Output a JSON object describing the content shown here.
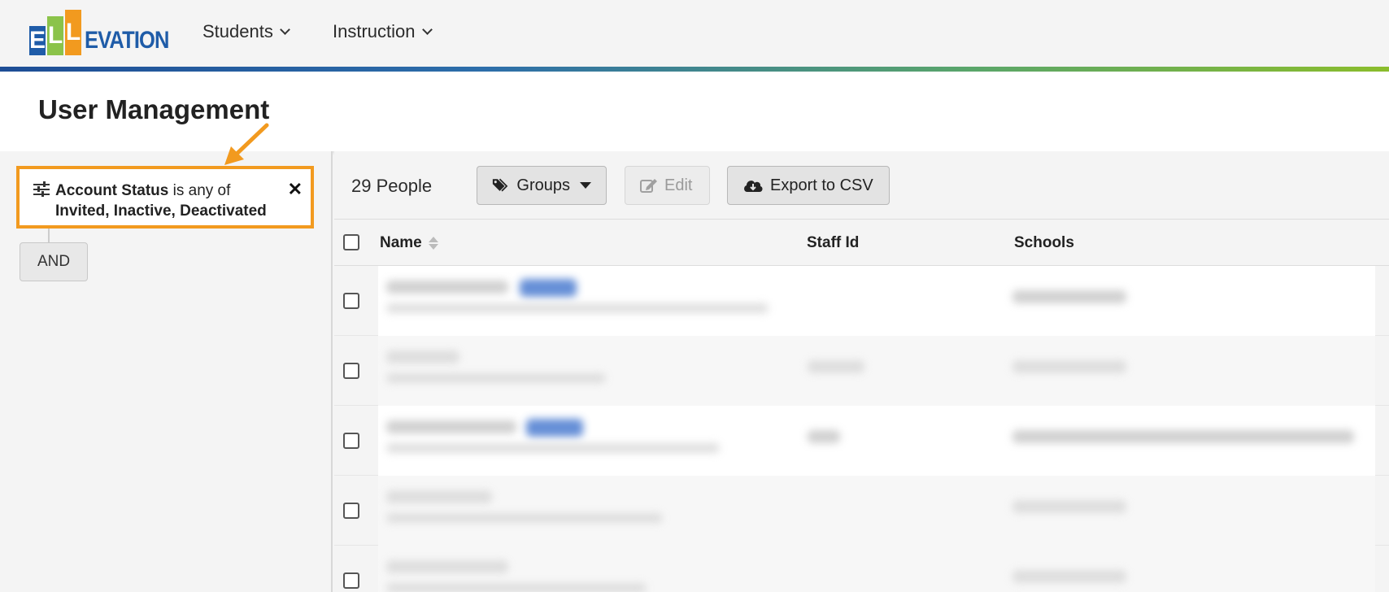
{
  "app": {
    "logo_text": "ELLEVATION",
    "logo_tiles": [
      "E",
      "L",
      "L"
    ],
    "logo_rest": "EVATION"
  },
  "nav": {
    "items": [
      {
        "label": "Students"
      },
      {
        "label": "Instruction"
      }
    ]
  },
  "page": {
    "title": "User Management"
  },
  "filter": {
    "field": "Account Status",
    "operator": "is any of",
    "values": "Invited, Inactive, Deactivated",
    "connector_label": "AND",
    "highlight_color": "#f29a1f"
  },
  "toolbar": {
    "count_label": "29 People",
    "groups_label": "Groups",
    "edit_label": "Edit",
    "export_label": "Export to CSV"
  },
  "table": {
    "columns": [
      "Name",
      "Staff Id",
      "Schools"
    ],
    "rows_note": "row contents are blurred and unreadable"
  },
  "colors": {
    "accent_orange": "#f29a1f",
    "brand_blue": "#1f5ca8",
    "brand_green": "#8bc34a"
  }
}
